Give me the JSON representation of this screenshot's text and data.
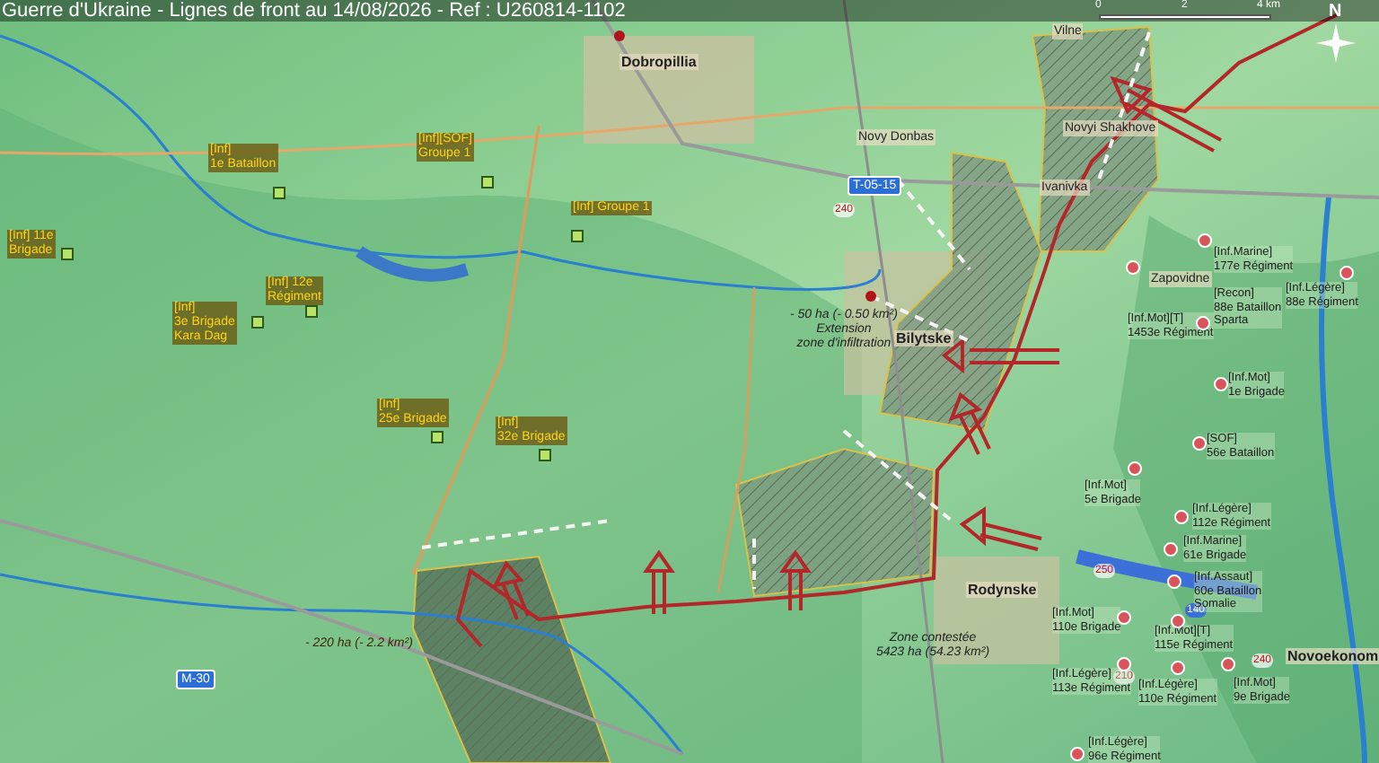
{
  "header": {
    "title": "Guerre d'Ukraine - Lignes de front au 14/08/2026 - Ref : U260814-1102"
  },
  "scale_bar": {
    "ticks": [
      "0",
      "2",
      "4 km"
    ]
  },
  "compass": {
    "label": "N"
  },
  "places": [
    {
      "name": "Dobropillia"
    },
    {
      "name": "Novy Donbas"
    },
    {
      "name": "Vilne"
    },
    {
      "name": "Novyi Shakhove"
    },
    {
      "name": "Ivanivka"
    },
    {
      "name": "Zapovidne"
    },
    {
      "name": "Bilytske"
    },
    {
      "name": "Rodynske"
    },
    {
      "name": "Novoekonom"
    }
  ],
  "road_badges": [
    {
      "label": "T-05-15"
    },
    {
      "label": "M-30"
    }
  ],
  "elevations": [
    {
      "label": "240",
      "kind": "spot"
    },
    {
      "label": "250",
      "kind": "spot"
    },
    {
      "label": "210",
      "kind": "spot"
    },
    {
      "label": "240",
      "kind": "spot"
    },
    {
      "label": "140",
      "kind": "lake"
    }
  ],
  "annotations": [
    {
      "kind": "infiltration",
      "lines": [
        "- 50 ha (- 0.50 km²)",
        "Extension",
        "zone d'infiltration"
      ]
    },
    {
      "kind": "loss",
      "lines": [
        "- 220 ha (- 2.2 km²)"
      ]
    },
    {
      "kind": "contested",
      "lines": [
        "Zone contestée",
        "5423 ha (54.23 km²)"
      ]
    }
  ],
  "ukrainian_units": [
    {
      "lines": [
        "[Inf]",
        "1e Bataillon"
      ]
    },
    {
      "lines": [
        "[Inf][SOF]",
        "Groupe 1"
      ]
    },
    {
      "lines": [
        "[Inf] Groupe 1"
      ]
    },
    {
      "lines": [
        "[Inf] 11e",
        "Brigade"
      ]
    },
    {
      "lines": [
        "[Inf]",
        "3e Brigade",
        "Kara Dag"
      ]
    },
    {
      "lines": [
        "[Inf] 12e",
        "Régiment"
      ]
    },
    {
      "lines": [
        "[Inf]",
        "25e Brigade"
      ]
    },
    {
      "lines": [
        "[Inf]",
        "32e Brigade"
      ]
    }
  ],
  "russian_units": [
    {
      "lines": [
        "[Inf.Marine]",
        "177e Régiment"
      ]
    },
    {
      "lines": [
        "[Inf.Mot][T]",
        "1453e Régiment"
      ]
    },
    {
      "lines": [
        "[Recon]",
        "88e Bataillon",
        "Sparta"
      ]
    },
    {
      "lines": [
        "[Inf.Légère]",
        "88e Régiment"
      ]
    },
    {
      "lines": [
        "[Inf.Mot]",
        "1e Brigade"
      ]
    },
    {
      "lines": [
        "[SOF]",
        "56e Bataillon"
      ]
    },
    {
      "lines": [
        "[Inf.Mot]",
        "5e Brigade"
      ]
    },
    {
      "lines": [
        "[Inf.Légère]",
        "112e Régiment"
      ]
    },
    {
      "lines": [
        "[Inf.Marine]",
        "61e Brigade"
      ]
    },
    {
      "lines": [
        "[Inf.Assaut]",
        "60e Bataillon",
        "Somalie"
      ]
    },
    {
      "lines": [
        "[Inf.Mot]",
        "110e Brigade"
      ]
    },
    {
      "lines": [
        "[Inf.Mot][T]",
        "115e Régiment"
      ]
    },
    {
      "lines": [
        "[Inf.Légère]",
        "113e Régiment"
      ]
    },
    {
      "lines": [
        "[Inf.Légère]",
        "110e Régiment"
      ]
    },
    {
      "lines": [
        "[Inf.Mot]",
        "9e Brigade"
      ]
    },
    {
      "lines": [
        "[Inf.Légère]",
        "96e Régiment"
      ]
    }
  ]
}
